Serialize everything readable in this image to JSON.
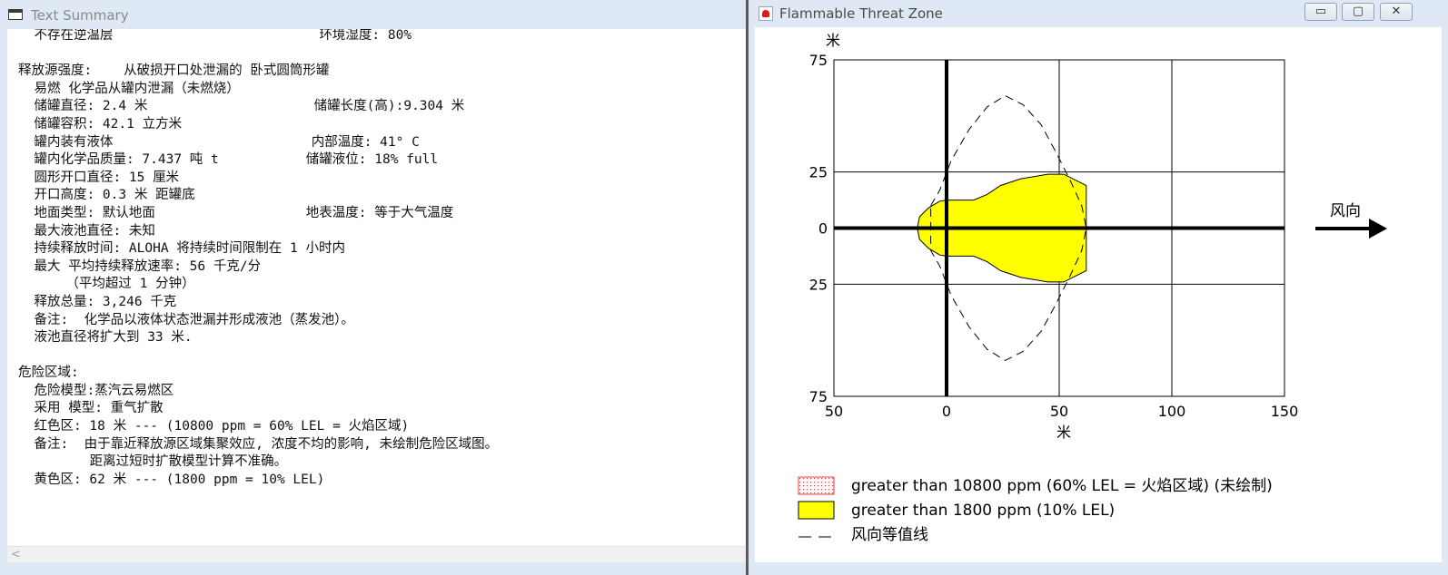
{
  "left_window": {
    "title": "Text Summary",
    "lines": [
      "  不存在逆温层                          环境湿度: 80%",
      "",
      "释放源强度:    从破损开口处泄漏的 卧式圆筒形罐",
      "  易燃 化学品从罐内泄漏（未燃烧）",
      "  储罐直径: 2.4 米                     储罐长度(高):9.304 米",
      "  储罐容积: 42.1 立方米",
      "  罐内装有液体                         内部温度: 41° C",
      "  罐内化学品质量: 7.437 吨 t           储罐液位: 18% full",
      "  圆形开口直径: 15 厘米",
      "  开口高度: 0.3 米 距罐底",
      "  地面类型: 默认地面                   地表温度: 等于大气温度",
      "  最大液池直径: 未知",
      "  持续释放时间: ALOHA 将持续时间限制在 1 小时内",
      "  最大 平均持续释放速率: 56 千克/分",
      "      （平均超过 1 分钟）",
      "  释放总量: 3,246 千克",
      "  备注:  化学品以液体状态泄漏并形成液池（蒸发池）。",
      "  液池直径将扩大到 33 米.",
      "",
      "危险区域:",
      "  危险模型:蒸汽云易燃区",
      "  采用 模型: 重气扩散",
      "  红色区: 18 米 --- (10800 ppm = 60% LEL = 火焰区域)",
      "  备注:  由于靠近释放源区域集聚效应, 浓度不均的影响, 未绘制危险区域图。",
      "         距离过短时扩散模型计算不准确。",
      "  黄色区: 62 米 --- (1800 ppm = 10% LEL)"
    ]
  },
  "right_window": {
    "title": "Flammable Threat Zone",
    "buttons": {
      "minimize": "▭",
      "maximize": "▢",
      "close": "✕"
    }
  },
  "chart_data": {
    "type": "area",
    "x_unit": "米",
    "y_unit": "米",
    "xlim": [
      -50,
      150
    ],
    "ylim": [
      -75,
      75
    ],
    "x_ticks": [
      -50,
      0,
      50,
      100,
      150
    ],
    "x_tick_labels": [
      "50",
      "0",
      "50",
      "100",
      "150"
    ],
    "y_ticks": [
      75,
      25,
      0,
      -25,
      -75
    ],
    "y_tick_labels": [
      "75",
      "25",
      "0",
      "25",
      "75"
    ],
    "grid": true,
    "wind_label": "风向",
    "yellow_zone_outline": [
      [
        -13,
        0
      ],
      [
        -12,
        5
      ],
      [
        -8,
        9
      ],
      [
        -3,
        12
      ],
      [
        0,
        12.5
      ],
      [
        12,
        12.5
      ],
      [
        18,
        15
      ],
      [
        24,
        19
      ],
      [
        33,
        22
      ],
      [
        45,
        24
      ],
      [
        52,
        24
      ],
      [
        62,
        19
      ],
      [
        62,
        -19
      ],
      [
        52,
        -24
      ],
      [
        45,
        -24
      ],
      [
        33,
        -22
      ],
      [
        24,
        -19
      ],
      [
        18,
        -15
      ],
      [
        12,
        -12.5
      ],
      [
        0,
        -12.5
      ],
      [
        -3,
        -12
      ],
      [
        -8,
        -9
      ],
      [
        -12,
        -5
      ]
    ],
    "confidence_line_outline": [
      [
        -7,
        10
      ],
      [
        -3,
        17
      ],
      [
        2,
        30
      ],
      [
        10,
        44
      ],
      [
        18,
        54
      ],
      [
        26,
        59
      ],
      [
        34,
        55
      ],
      [
        42,
        46
      ],
      [
        49,
        33
      ],
      [
        55,
        21
      ],
      [
        60,
        10
      ],
      [
        62,
        0
      ],
      [
        60,
        -10
      ],
      [
        55,
        -21
      ],
      [
        49,
        -33
      ],
      [
        42,
        -46
      ],
      [
        34,
        -55
      ],
      [
        26,
        -59
      ],
      [
        18,
        -54
      ],
      [
        10,
        -44
      ],
      [
        2,
        -30
      ],
      [
        -3,
        -17
      ],
      [
        -7,
        -10
      ]
    ],
    "legend": [
      {
        "label": "greater than 10800 ppm (60% LEL = 火焰区域) (未绘制)",
        "swatch": "red-dotted"
      },
      {
        "label": "greater than 1800 ppm (10% LEL)",
        "swatch": "yellow"
      },
      {
        "label": "风向等值线",
        "swatch": "dashed-line"
      }
    ],
    "colors": {
      "yellow": "#ffff00",
      "red_dots": "#e04040",
      "axis": "#000000"
    }
  }
}
